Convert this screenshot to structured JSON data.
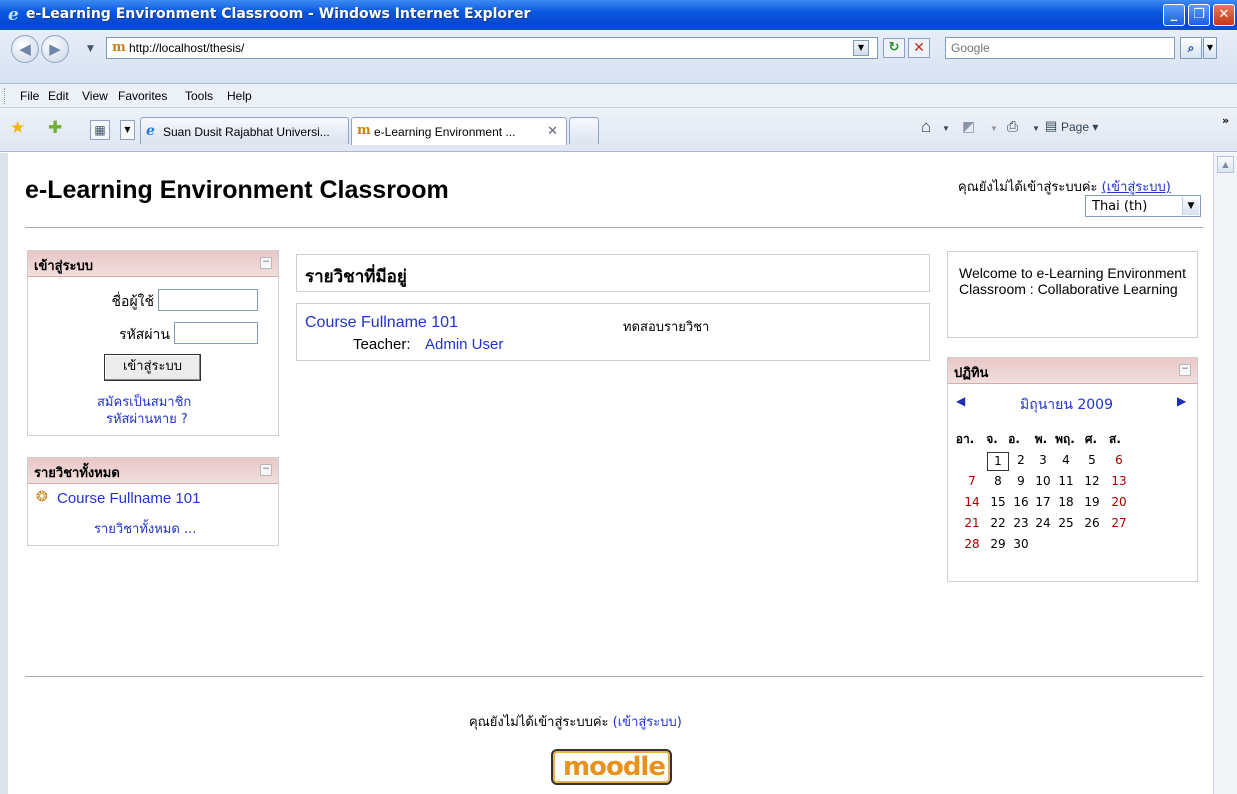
{
  "window": {
    "title": "e-Learning Environment Classroom - Windows Internet Explorer"
  },
  "address_bar": {
    "url": "http://localhost/thesis/",
    "search_placeholder": "Google"
  },
  "menu": [
    "File",
    "Edit",
    "View",
    "Favorites",
    "Tools",
    "Help"
  ],
  "tabs": [
    {
      "label": "Suan Dusit Rajabhat Universi..."
    },
    {
      "label": "e-Learning Environment ..."
    }
  ],
  "toolbar": {
    "page_label": "Page"
  },
  "site": {
    "title": "e-Learning Environment Classroom",
    "login_status": "คุณยังไม่ได้เข้าสู่ระบบค่ะ",
    "login_link": "(เข้าสู่ระบบ)",
    "language": "Thai (th)"
  },
  "login_block": {
    "title": "เข้าสู่ระบบ",
    "username_label": "ชื่อผู้ใช้",
    "password_label": "รหัสผ่าน",
    "login_button": "เข้าสู่ระบบ",
    "signup_link": "สมัครเป็นสมาชิก",
    "forgot_link": "รหัสผ่านหาย ?"
  },
  "courses_block": {
    "title": "รายวิชาทั้งหมด",
    "course": "Course Fullname 101",
    "all_link": "รายวิชาทั้งหมด ..."
  },
  "main": {
    "heading": "รายวิชาที่มีอยู่",
    "course_name": "Course Fullname 101",
    "course_summary": "ทดสอบรายวิชา",
    "teacher_label": "Teacher:",
    "teacher_name": "Admin User"
  },
  "welcome": {
    "text": "Welcome to e-Learning Environment Classroom : Collaborative Learning"
  },
  "calendar": {
    "title": "ปฏิทิน",
    "month": "มิถุนายน 2009",
    "day_headers": [
      "อา.",
      "จ.",
      "อ.",
      "พ.",
      "พฤ.",
      "ศ.",
      "ส."
    ],
    "start_weekday": 1,
    "days": 30,
    "today": 1
  },
  "footer": {
    "login_status": "คุณยังไม่ได้เข้าสู่ระบบค่ะ",
    "login_link": "(เข้าสู่ระบบ)",
    "logo_text": "moodle"
  }
}
